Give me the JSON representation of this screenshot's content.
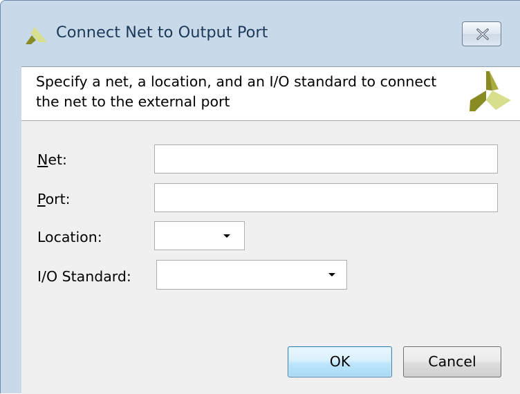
{
  "dialog": {
    "title": "Connect Net to Output Port",
    "close_icon": "close-x-icon",
    "header_text": "Specify a net, a location, and an I/O standard to connect the net to the external port",
    "logo_icon": "xilinx-logo-icon"
  },
  "form": {
    "net": {
      "label_mnemonic": "N",
      "label_rest": "et:",
      "value": ""
    },
    "port": {
      "label_mnemonic": "P",
      "label_rest": "ort:",
      "value": ""
    },
    "location": {
      "label": "Location:",
      "value": ""
    },
    "io_standard": {
      "label": "I/O Standard:",
      "value": ""
    }
  },
  "buttons": {
    "ok": "OK",
    "cancel": "Cancel"
  },
  "colors": {
    "logo_dark": "#888a22",
    "logo_light": "#d7de8c",
    "title_text": "#1e3958",
    "window_frame": "#c8daea",
    "content_bg": "#f0f0f0",
    "ok_border": "#3c7fb1"
  }
}
